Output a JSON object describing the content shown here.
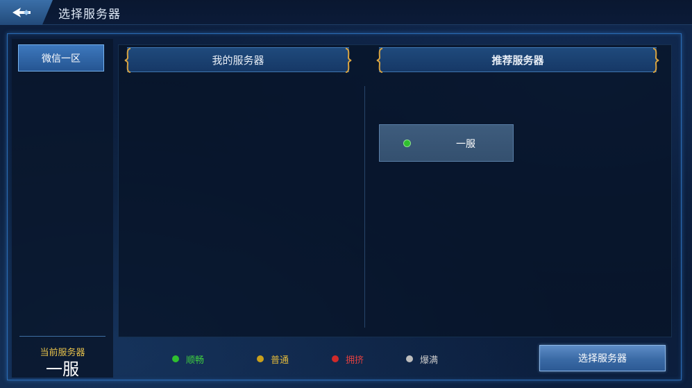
{
  "header": {
    "title": "选择服务器",
    "back_icon": "back-arrow-icon"
  },
  "sidebar": {
    "zones": [
      {
        "label": "微信一区",
        "selected": true
      }
    ],
    "current_server_label": "当前服务器",
    "current_server_value": "一服"
  },
  "tabs": {
    "my_servers": "我的服务器",
    "recommended": "推荐服务器"
  },
  "recommended_servers": [
    {
      "name": "一服",
      "status": "顺畅",
      "status_color": "#2fbf2f"
    }
  ],
  "legend": [
    {
      "label": "顺畅",
      "color": "#2fbf2f",
      "text_color": "#3fcf3f"
    },
    {
      "label": "普通",
      "color": "#c9a01c",
      "text_color": "#e0b83a"
    },
    {
      "label": "拥挤",
      "color": "#d02a2a",
      "text_color": "#e04040"
    },
    {
      "label": "爆满",
      "color": "#bdbdbd",
      "text_color": "#c8c8c8"
    }
  ],
  "actions": {
    "select_server": "选择服务器"
  }
}
